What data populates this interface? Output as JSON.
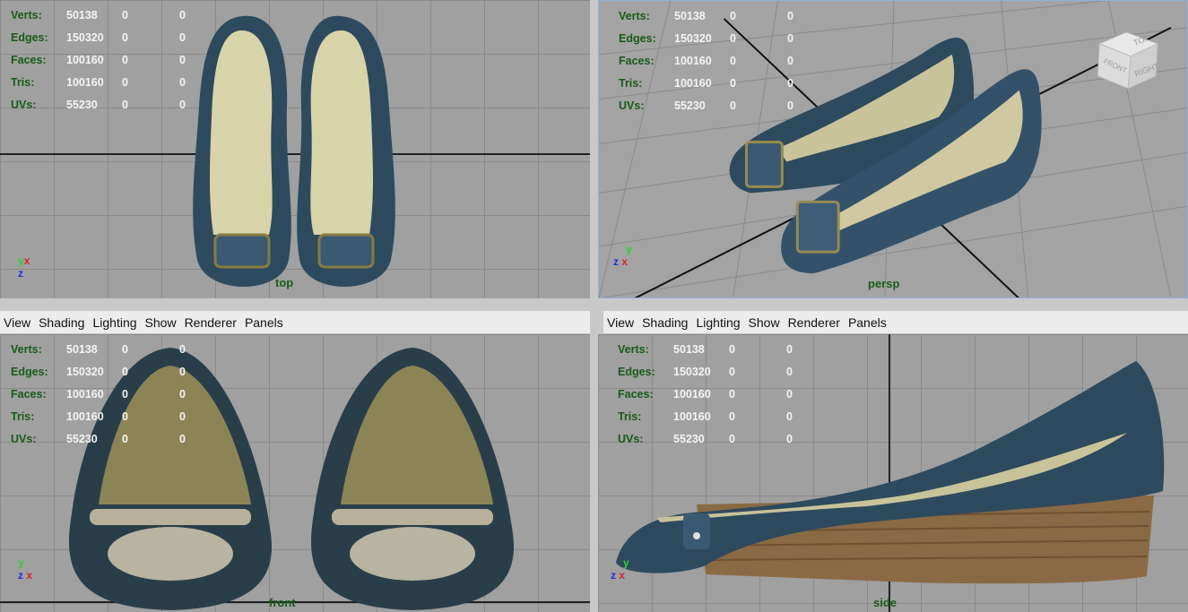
{
  "stats": {
    "labels": [
      "Verts:",
      "Edges:",
      "Faces:",
      "Tris:",
      "UVs:"
    ],
    "values": [
      [
        "50138",
        "0",
        "0"
      ],
      [
        "150320",
        "0",
        "0"
      ],
      [
        "100160",
        "0",
        "0"
      ],
      [
        "100160",
        "0",
        "0"
      ],
      [
        "55230",
        "0",
        "0"
      ]
    ]
  },
  "menu": [
    "View",
    "Shading",
    "Lighting",
    "Show",
    "Renderer",
    "Panels"
  ],
  "viewports": {
    "top": {
      "name": "top"
    },
    "persp": {
      "name": "persp"
    },
    "front": {
      "name": "front"
    },
    "side": {
      "name": "side"
    }
  },
  "viewcube": {
    "top": "TOP",
    "front": "FRONT",
    "right": "RIGHT"
  },
  "axes": {
    "x": "x",
    "y": "y",
    "z": "z"
  },
  "colors": {
    "grid_bg": "#a0a0a0",
    "hud_label": "#1a5a1a",
    "shoe_blue": "#2e4a5e",
    "insole": "#d8d3a8"
  }
}
